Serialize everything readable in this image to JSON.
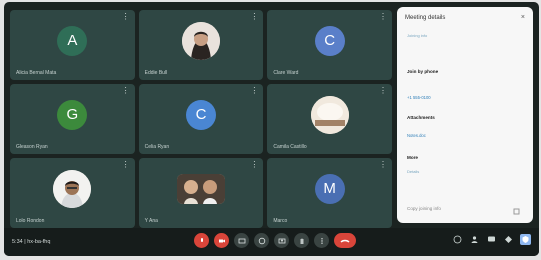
{
  "tiles": [
    {
      "name": "Alicia Bernal Mata",
      "initial": "A",
      "color": "#2f6e57",
      "kind": "letter"
    },
    {
      "name": "Eddie Bull",
      "kind": "photo"
    },
    {
      "name": "Clare Ward",
      "initial": "C",
      "color": "#5a7fc9",
      "kind": "letter"
    },
    {
      "name": "Gleason Ryan",
      "initial": "G",
      "color": "#3c8a3c",
      "kind": "letter"
    },
    {
      "name": "Celia Ryan",
      "initial": "C",
      "color": "#4a86d3",
      "kind": "letter"
    },
    {
      "name": "Camila Castillo",
      "kind": "photo-cream"
    },
    {
      "name": "Lolo Rondon",
      "kind": "photo"
    },
    {
      "name": "Y Ana",
      "kind": "photo-dual"
    },
    {
      "name": "Marco",
      "initial": "M",
      "color": "#4a6fb3",
      "kind": "letter"
    }
  ],
  "bottom_bar": {
    "meeting_label": "5:34 | hx-ba-fhq"
  },
  "panel": {
    "title": "Meeting details",
    "close_icon": "close-icon",
    "section1_text": "Joining info",
    "section2_heading": "Join by phone",
    "section2_link": "+1 555-0100",
    "section3_heading": "Attachments",
    "section3_link": "Notes.doc",
    "section4_heading": "More",
    "section4_text": "Details",
    "footer_text": "Copy joining info"
  },
  "colors": {
    "tile_bg": "#2f4744",
    "screen_bg": "#1b2321",
    "end_call": "#d9453a",
    "panel_bg": "#f7f7f7",
    "active_icon": "#8fb8f0"
  }
}
